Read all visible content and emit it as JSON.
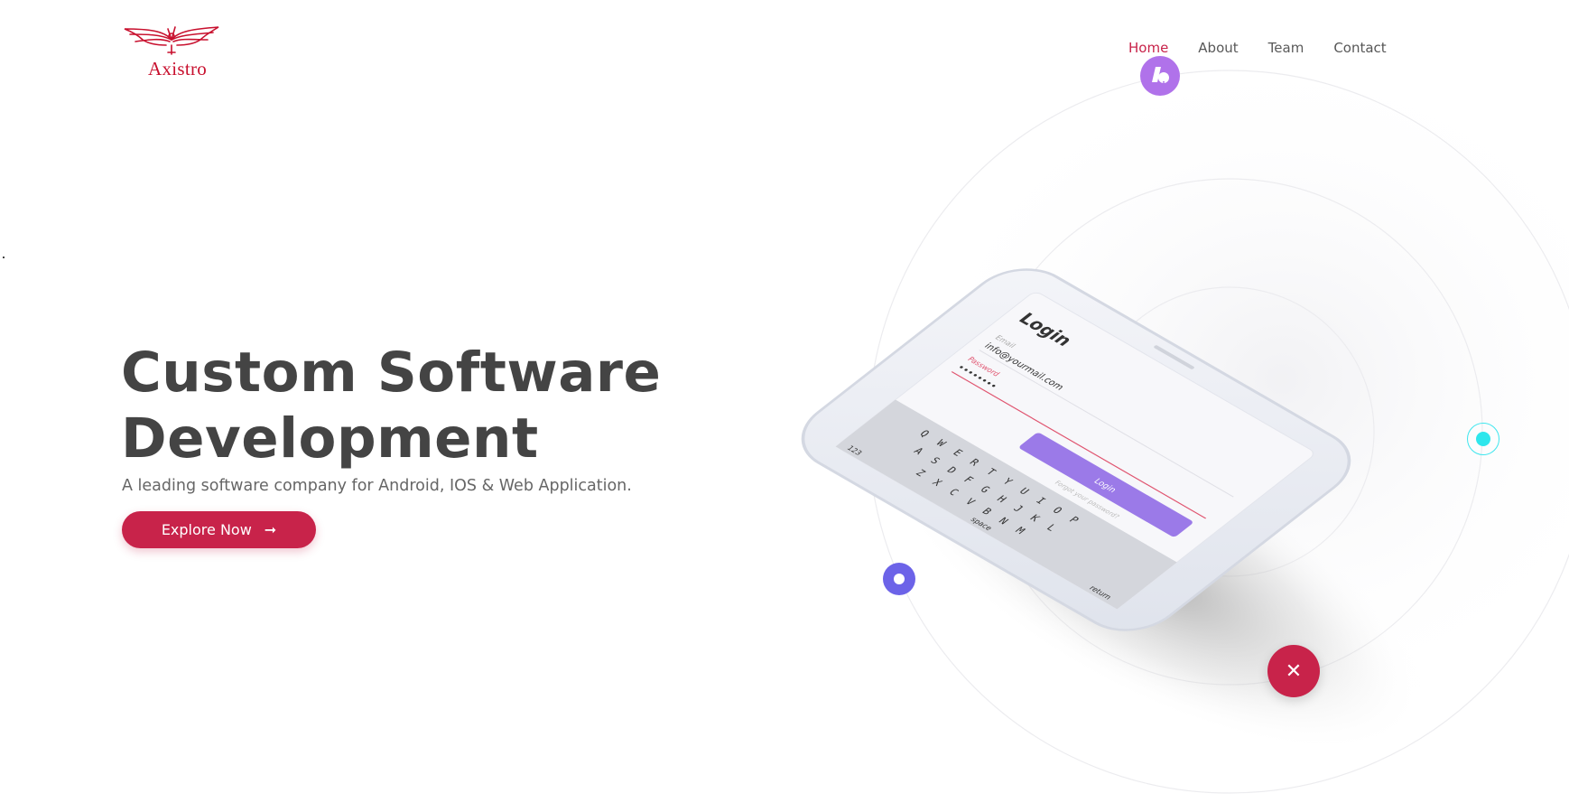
{
  "brand": {
    "name": "Axistro",
    "color": "#c8102e"
  },
  "nav": {
    "items": [
      {
        "label": "Home",
        "active": true
      },
      {
        "label": "About",
        "active": false
      },
      {
        "label": "Team",
        "active": false
      },
      {
        "label": "Contact",
        "active": false
      }
    ]
  },
  "hero": {
    "title_line1": "Custom Software",
    "title_line2": "Development",
    "subtitle": "A leading software company for Android, IOS & Web Application.",
    "cta_label": "Explore Now",
    "cta_icon": "arrow-right-icon"
  },
  "phone": {
    "screen_title": "Login",
    "email_label": "Email",
    "email_value": "info@yourmail.com",
    "password_label": "Password",
    "password_value": "••••••••",
    "login_button": "Login",
    "forgot_link": "Forgot your password?",
    "keyboard_rows": [
      "Q W E R T Y U I O P",
      "A S D F G H J K L",
      "Z X C V B N M"
    ],
    "key_123": "123",
    "key_space": "space",
    "key_return": "return"
  },
  "colors": {
    "accent": "#c8234a",
    "purple": "#b072ea",
    "blue": "#6c63e8",
    "cyan": "#2ee6ec",
    "phone_button": "#9b7ae8"
  },
  "floating_icons": [
    "app-badge-icon",
    "ring-dot-icon",
    "cyan-dot-icon",
    "plus-icon"
  ]
}
